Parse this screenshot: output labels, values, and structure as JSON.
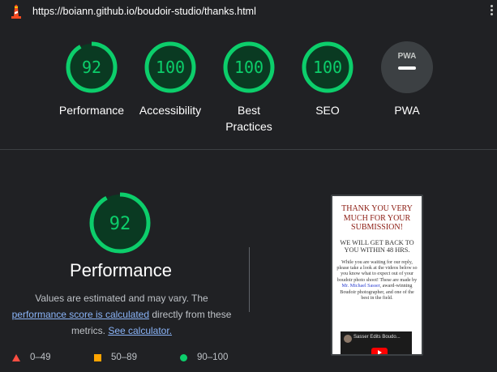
{
  "topbar": {
    "url": "https://boiann.github.io/boudoir-studio/thanks.html",
    "logo_icon": "lighthouse-icon",
    "menu_icon": "kebab-menu-icon"
  },
  "scores": [
    {
      "id": "performance",
      "score": "92",
      "value": 92,
      "label": "Performance"
    },
    {
      "id": "accessibility",
      "score": "100",
      "value": 100,
      "label": "Accessibility"
    },
    {
      "id": "best-practices",
      "score": "100",
      "value": 100,
      "label": "Best Practices"
    },
    {
      "id": "seo",
      "score": "100",
      "value": 100,
      "label": "SEO"
    }
  ],
  "pwa": {
    "badge": "PWA",
    "label": "PWA"
  },
  "performance": {
    "score": "92",
    "value": 92,
    "title": "Performance",
    "desc_before": "Values are estimated and may vary. The ",
    "desc_link": "performance score is calculated",
    "desc_middle": " directly from these metrics. ",
    "desc_link2": "See calculator."
  },
  "legend": [
    {
      "shape": "triangle",
      "range": "0–49",
      "color": "#ff4e42"
    },
    {
      "shape": "square",
      "range": "50–89",
      "color": "#ffa400"
    },
    {
      "shape": "circle",
      "range": "90–100",
      "color": "#0cce6b"
    }
  ],
  "screenshot": {
    "heading": "THANK YOU VERY MUCH FOR YOUR SUBMISSION!",
    "subheading": "WE WILL GET BACK TO YOU WITHIN 48 HRS.",
    "body_before": "While you are waiting for our reply, please take a look at the videos below so you know what to expect out of your boudoir photo shoot! These are made by ",
    "body_link": "Mr. Michael Sasser",
    "body_after": ", award-winning Boudoir photographer, and one of the best in the field.",
    "video_title": "Sasser Edits Boudo..."
  },
  "colors": {
    "pass": "#0cce6b",
    "pass_fill": "#0a3a22",
    "average": "#ffa400",
    "fail": "#ff4e42",
    "background": "#202124",
    "link": "#8ab4f8"
  }
}
